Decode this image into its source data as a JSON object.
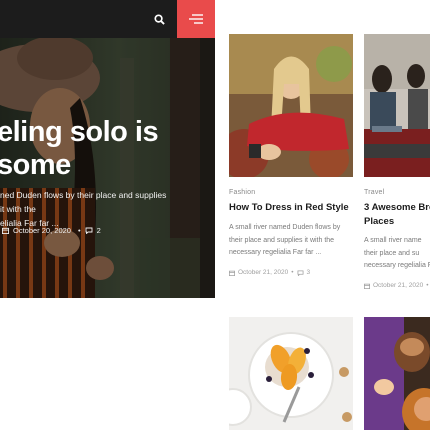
{
  "header": {
    "search_icon": "search-icon",
    "menu_icon": "hamburger-menu-icon",
    "accent_color": "#e94b4b"
  },
  "hero": {
    "title": "eling solo is\nsome",
    "excerpt": "ned Duden flows by their place and supplies it with the\nelialia Far far ...",
    "date": "October 20, 2020",
    "comments": "2"
  },
  "cards": [
    {
      "category": "Fashion",
      "title": "How To Dress in Red Style",
      "excerpt": "A small river named Duden flows by their place and supplies it with the necessary regelialia Far far ...",
      "date": "October 21, 2020",
      "comments": "3"
    },
    {
      "category": "Travel",
      "title": "3 Awesome Brea\nPlaces",
      "excerpt": "A small river name\ntheir place and su\nnecessary regelialia F",
      "date": "October 21, 2020",
      "comments": ""
    }
  ]
}
